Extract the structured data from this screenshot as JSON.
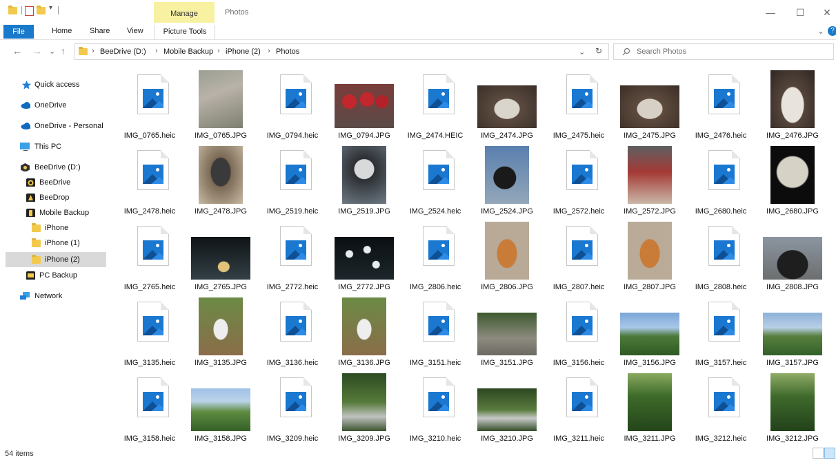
{
  "window": {
    "title": "Photos",
    "contextual_group": "Manage",
    "minimize": "—",
    "maximize": "☐",
    "close": "✕",
    "qa_dropdown": "▾",
    "ribbon_expand": "⌄",
    "help": "?"
  },
  "ribbon": {
    "tabs": [
      "File",
      "Home",
      "Share",
      "View",
      "Picture Tools"
    ]
  },
  "nav": {
    "back": "←",
    "forward": "→",
    "recent": "⌄",
    "up": "↑",
    "address_dropdown": "⌄",
    "refresh": "↻"
  },
  "breadcrumb": [
    "BeeDrive (D:)",
    "Mobile Backup",
    "iPhone (2)",
    "Photos"
  ],
  "breadcrumb_sep": "›",
  "search": {
    "placeholder": "Search Photos",
    "icon": "search-icon"
  },
  "sidebar": {
    "items": [
      {
        "label": "Quick access",
        "icon": "star-icon"
      },
      {
        "label": "OneDrive",
        "icon": "cloud-icon"
      },
      {
        "label": "OneDrive - Personal",
        "icon": "cloud-icon"
      },
      {
        "label": "This PC",
        "icon": "monitor-icon"
      },
      {
        "label": "BeeDrive (D:)",
        "icon": "drive-icon"
      },
      {
        "label": "BeeDrive",
        "icon": "beedrive-app-icon"
      },
      {
        "label": "BeeDrop",
        "icon": "beedrop-app-icon"
      },
      {
        "label": "Mobile Backup",
        "icon": "phone-icon"
      },
      {
        "label": "iPhone",
        "icon": "folder-icon"
      },
      {
        "label": "iPhone (1)",
        "icon": "folder-icon"
      },
      {
        "label": "iPhone (2)",
        "icon": "folder-icon"
      },
      {
        "label": "PC Backup",
        "icon": "monitor-icon"
      },
      {
        "label": "Network",
        "icon": "network-icon"
      }
    ]
  },
  "files": [
    "IMG_0765.heic",
    "IMG_0765.JPG",
    "IMG_0794.heic",
    "IMG_0794.JPG",
    "IMG_2474.HEIC",
    "IMG_2474.JPG",
    "IMG_2475.heic",
    "IMG_2475.JPG",
    "IMG_2476.heic",
    "IMG_2476.JPG",
    "IMG_2478.heic",
    "IMG_2478.JPG",
    "IMG_2519.heic",
    "IMG_2519.JPG",
    "IMG_2524.heic",
    "IMG_2524.JPG",
    "IMG_2572.heic",
    "IMG_2572.JPG",
    "IMG_2680.heic",
    "IMG_2680.JPG",
    "IMG_2765.heic",
    "IMG_2765.JPG",
    "IMG_2772.heic",
    "IMG_2772.JPG",
    "IMG_2806.heic",
    "IMG_2806.JPG",
    "IMG_2807.heic",
    "IMG_2807.JPG",
    "IMG_2808.heic",
    "IMG_2808.JPG",
    "IMG_3135.heic",
    "IMG_3135.JPG",
    "IMG_3136.heic",
    "IMG_3136.JPG",
    "IMG_3151.heic",
    "IMG_3151.JPG",
    "IMG_3156.heic",
    "IMG_3156.JPG",
    "IMG_3157.heic",
    "IMG_3157.JPG",
    "IMG_3158.heic",
    "IMG_3158.JPG",
    "IMG_3209.heic",
    "IMG_3209.JPG",
    "IMG_3210.heic",
    "IMG_3210.JPG",
    "IMG_3211.heic",
    "IMG_3211.JPG",
    "IMG_3212.heic",
    "IMG_3212.JPG"
  ],
  "status": {
    "item_count": "54 items"
  },
  "colors": {
    "file_tab": "#1979ca",
    "manage_tab": "#f7f1a1",
    "selection": "#d9d9d9",
    "image_icon": "#1a78d1"
  }
}
